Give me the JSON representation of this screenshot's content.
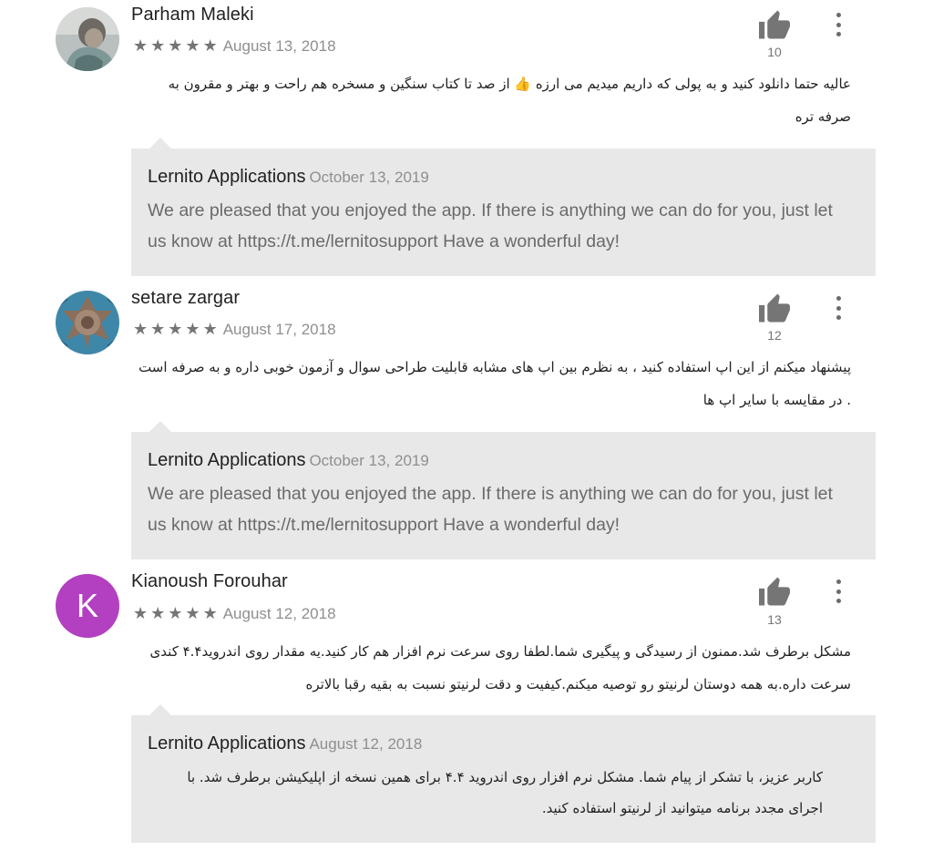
{
  "reviews": [
    {
      "author": "Parham Maleki",
      "stars": "★★★★★",
      "rating": 5,
      "date": "August 13, 2018",
      "likes": "10",
      "avatar": "photo",
      "text_line1": "عالیه حتما دانلود کنید و به پولی که داریم میدیم می ارزه 👍 از صد تا کتاب سنگین و مسخره هم راحت و بهتر و مقرون به",
      "text_line2": "صرفه تره",
      "reply": {
        "developer": "Lernito Applications",
        "date": "October 13, 2019",
        "text_line1": "We are pleased that you enjoyed the app. If there is anything we can do for you, just let",
        "text_line2": "us know at https://t.me/lernitosupport Have a wonderful day!"
      }
    },
    {
      "author": "setare zargar",
      "stars": "★★★★★",
      "rating": 5,
      "date": "August 17, 2018",
      "likes": "12",
      "avatar": "tile-pattern",
      "text_line1": "پیشنهاد میکنم از این اپ استفاده کنید ، به نظرم بین اپ های مشابه قابلیت طراحی سوال و آزمون خوبی داره و به صرفه است",
      "text_line2": ". در مقایسه با سایر اپ ها",
      "reply": {
        "developer": "Lernito Applications",
        "date": "October 13, 2019",
        "text_line1": "We are pleased that you enjoyed the app. If there is anything we can do for you, just let",
        "text_line2": "us know at https://t.me/lernitosupport Have a wonderful day!"
      }
    },
    {
      "author": "Kianoush Forouhar",
      "stars": "★★★★★",
      "rating": 5,
      "date": "August 12, 2018",
      "likes": "13",
      "avatar_letter": "K",
      "avatar_color": "#b33fc1",
      "text_line1": "مشکل برطرف شد.ممنون از رسیدگی و پیگیری شما.لطفا روی سرعت نرم افزار هم کار کنید.یه مقدار روی اندروید۴.۴ کندی",
      "text_line2": "سرعت داره.به همه دوستان لرنیتو رو توصیه میکنم.کیفیت و دقت لرنیتو نسبت به بقیه رقبا بالاتره",
      "reply": {
        "developer": "Lernito Applications",
        "date": "August 12, 2018",
        "text_line1": "کاربر عزیز، با تشکر از پیام شما. مشکل نرم افزار روی اندروید ۴.۴ برای همین نسخه از اپلیکیشن برطرف شد. با",
        "text_line2": "اجرای مجدد برنامه میتوانید از لرنیتو استفاده کنید."
      }
    }
  ],
  "colors": {
    "reply_background": "#e8e8e8",
    "icon_grey": "#757575",
    "avatar_k": "#b33fc1"
  }
}
